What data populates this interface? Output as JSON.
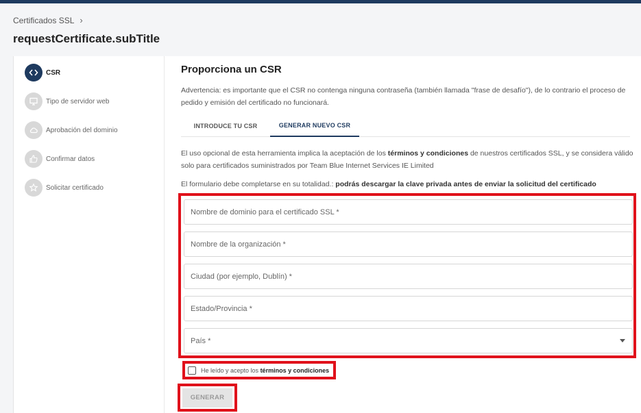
{
  "breadcrumb": {
    "item": "Certificados SSL"
  },
  "page_title": "requestCertificate.subTitle",
  "steps": [
    {
      "label": "CSR",
      "icon": "code-icon",
      "active": true
    },
    {
      "label": "Tipo de servidor web",
      "icon": "monitor-icon",
      "active": false
    },
    {
      "label": "Aprobación del dominio",
      "icon": "cloud-icon",
      "active": false
    },
    {
      "label": "Confirmar datos",
      "icon": "thumbs-up-icon",
      "active": false
    },
    {
      "label": "Solicitar certificado",
      "icon": "star-icon",
      "active": false
    }
  ],
  "main": {
    "title": "Proporciona un CSR",
    "warning": "Advertencia: es importante que el CSR no contenga ninguna contraseña (también llamada \"frase de desafío\"), de lo contrario el proceso de pedido y emisión del certificado no funcionará.",
    "tabs": [
      {
        "label": "INTRODUCE TU CSR",
        "active": false
      },
      {
        "label": "GENERAR NUEVO CSR",
        "active": true
      }
    ],
    "terms_pre": "El uso opcional de esta herramienta implica la aceptación de los ",
    "terms_bold": "términos y condiciones",
    "terms_post": " de nuestros certificados SSL, y se considera válido solo para certificados suministrados por Team Blue Internet Services IE Limited",
    "requirement_pre": "El formulario debe completarse en su totalidad.: ",
    "requirement_bold": "podrás descargar la clave privada antes de enviar la solicitud del certificado"
  },
  "form": {
    "fields": [
      {
        "placeholder": "Nombre de dominio para el certificado SSL *"
      },
      {
        "placeholder": "Nombre de la organización *"
      },
      {
        "placeholder": "Ciudad (por ejemplo, Dublín) *"
      },
      {
        "placeholder": "Estado/Provincia *"
      },
      {
        "placeholder": "País *"
      }
    ],
    "checkbox_pre": "He leído y acepto los ",
    "checkbox_bold": "términos y condiciones",
    "generate_label": "GENERAR"
  },
  "colors": {
    "accent": "#1e3a5f",
    "highlight": "#e0111b"
  }
}
